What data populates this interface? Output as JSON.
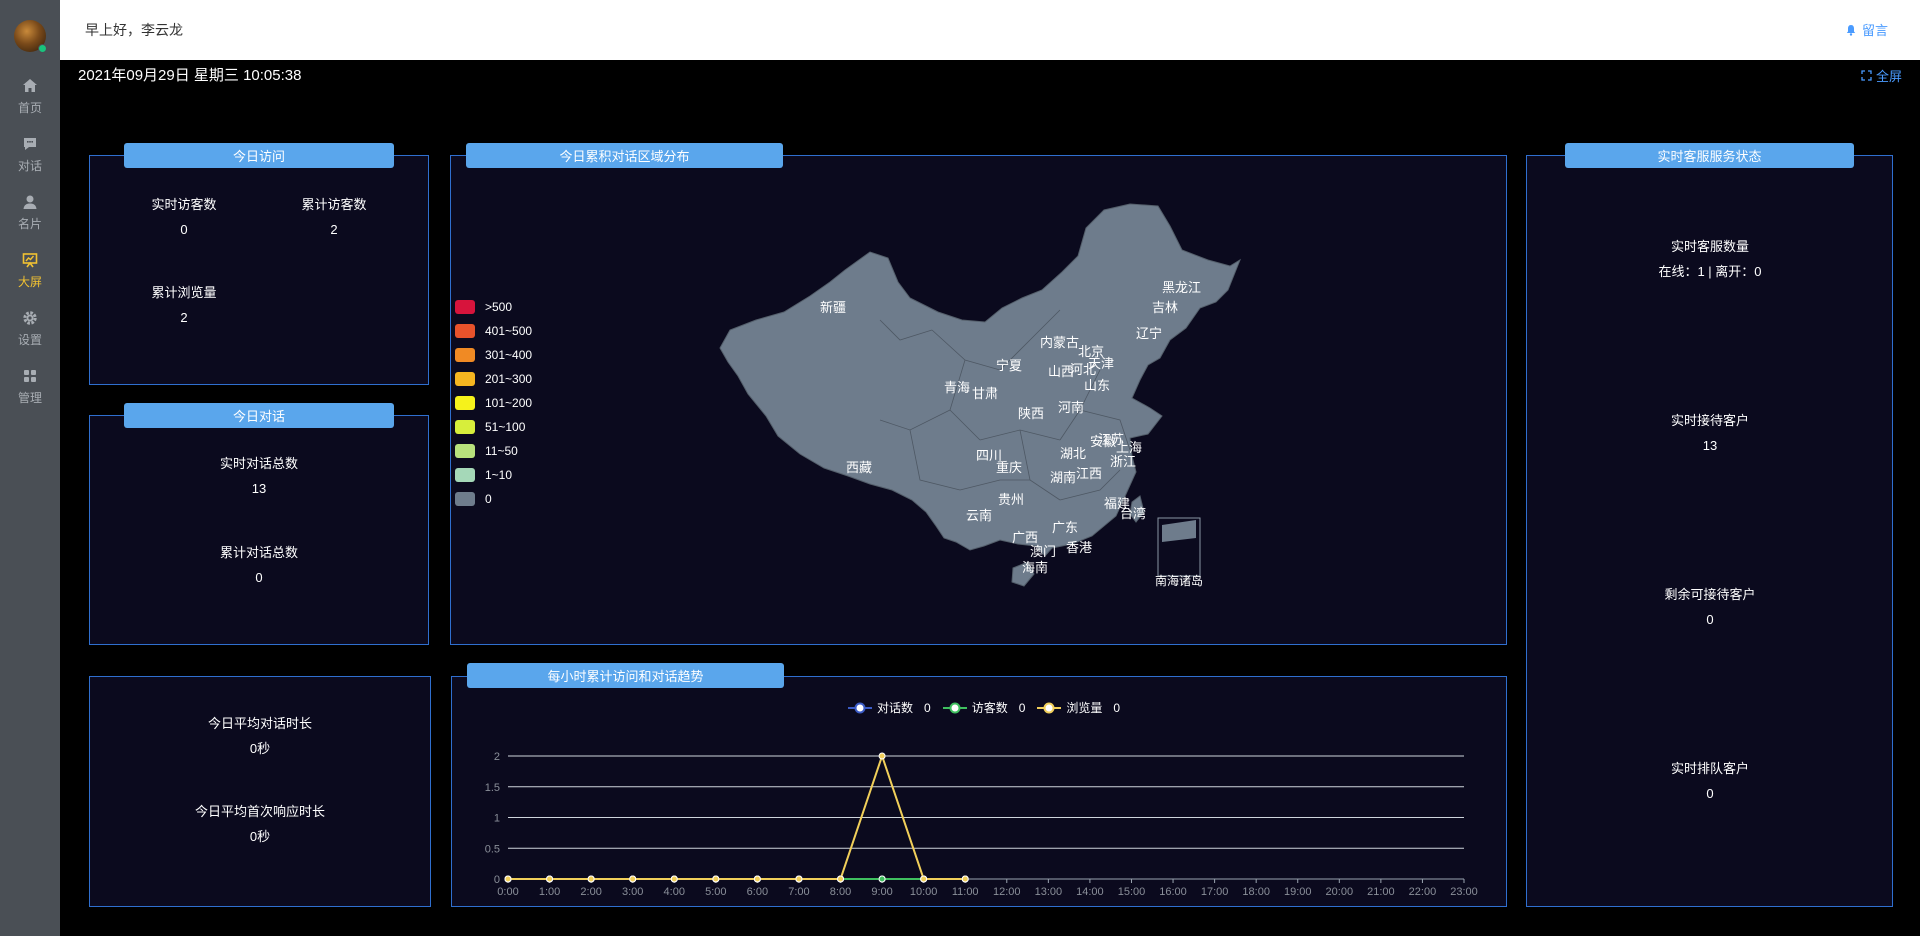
{
  "sidebar": {
    "items": [
      {
        "label": "首页",
        "icon": "home-icon"
      },
      {
        "label": "对话",
        "icon": "chat-icon"
      },
      {
        "label": "名片",
        "icon": "user-icon"
      },
      {
        "label": "大屏",
        "icon": "dashboard-icon",
        "active": true
      },
      {
        "label": "设置",
        "icon": "gear-icon"
      },
      {
        "label": "管理",
        "icon": "grid-icon"
      }
    ]
  },
  "header": {
    "greeting": "早上好，李云龙",
    "message_label": "留言"
  },
  "datetime": "2021年09月29日 星期三 10:05:38",
  "fullscreen_label": "全屏",
  "visits": {
    "title": "今日访问",
    "realtime_label": "实时访客数",
    "realtime_value": "0",
    "total_label": "累计访客数",
    "total_value": "2",
    "pageviews_label": "累计浏览量",
    "pageviews_value": "2"
  },
  "conversations": {
    "title": "今日对话",
    "realtime_label": "实时对话总数",
    "realtime_value": "13",
    "total_label": "累计对话总数",
    "total_value": "0"
  },
  "durations": {
    "avg_conv_label": "今日平均对话时长",
    "avg_conv_value": "0秒",
    "avg_first_label": "今日平均首次响应时长",
    "avg_first_value": "0秒"
  },
  "map": {
    "title": "今日累积对话区域分布",
    "legend": [
      {
        "label": ">500",
        "color": "#d7143c"
      },
      {
        "label": "401~500",
        "color": "#e8522b"
      },
      {
        "label": "301~400",
        "color": "#f08a24"
      },
      {
        "label": "201~300",
        "color": "#f5b520"
      },
      {
        "label": "101~200",
        "color": "#f6f21b"
      },
      {
        "label": "51~100",
        "color": "#d7ee3b"
      },
      {
        "label": "11~50",
        "color": "#b8e27c"
      },
      {
        "label": "1~10",
        "color": "#a5d8b8"
      },
      {
        "label": "0",
        "color": "#6e7c8c"
      }
    ],
    "provinces": [
      "黑龙江",
      "吉林",
      "辽宁",
      "内蒙古",
      "北京",
      "天津",
      "河北",
      "山西",
      "山东",
      "宁夏",
      "青海",
      "甘肃",
      "陕西",
      "河南",
      "新疆",
      "西藏",
      "四川",
      "重庆",
      "湖北",
      "安徽",
      "江苏",
      "上海",
      "浙江",
      "湖南",
      "江西",
      "贵州",
      "云南",
      "福建",
      "台湾",
      "广西",
      "广东",
      "澳门",
      "香港",
      "海南"
    ],
    "inset_label": "南海诸岛"
  },
  "service": {
    "title": "实时客服服务状态",
    "agents_label": "实时客服数量",
    "agents_value": "在线：1 | 离开：0",
    "serving_label": "实时接待客户",
    "serving_value": "13",
    "remaining_label": "剩余可接待客户",
    "remaining_value": "0",
    "queue_label": "实时排队客户",
    "queue_value": "0"
  },
  "trend": {
    "title": "每小时累计访问和对话趋势"
  },
  "chart_data": {
    "type": "line",
    "x": [
      "0:00",
      "1:00",
      "2:00",
      "3:00",
      "4:00",
      "5:00",
      "6:00",
      "7:00",
      "8:00",
      "9:00",
      "10:00",
      "11:00",
      "12:00",
      "13:00",
      "14:00",
      "15:00",
      "16:00",
      "17:00",
      "18:00",
      "19:00",
      "20:00",
      "21:00",
      "22:00",
      "23:00"
    ],
    "ylim": [
      0,
      2
    ],
    "yticks": [
      "0",
      "0.5",
      "1",
      "1.5",
      "2"
    ],
    "grid": true,
    "legend_position": "top",
    "series": [
      {
        "name": "对话数",
        "total": "0",
        "color": "#3b5bc5",
        "values": [
          0,
          0,
          0,
          0,
          0,
          0,
          0,
          0,
          0,
          0,
          0,
          0
        ]
      },
      {
        "name": "访客数",
        "total": "0",
        "color": "#3fbf5f",
        "values": [
          0,
          0,
          0,
          0,
          0,
          0,
          0,
          0,
          0,
          0,
          0,
          0
        ]
      },
      {
        "name": "浏览量",
        "total": "0",
        "color": "#f1cf5a",
        "values": [
          0,
          0,
          0,
          0,
          0,
          0,
          0,
          0,
          0,
          2,
          0,
          0
        ]
      }
    ]
  }
}
